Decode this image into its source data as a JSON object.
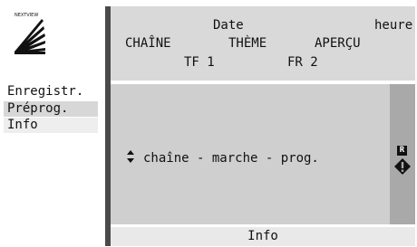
{
  "logo": {
    "text": "NEXTVIEW",
    "icon": "nextview-logo-icon"
  },
  "header": {
    "date_label": "Date",
    "time_label": "heure",
    "channel_label": "CHAÎNE",
    "theme_label": "THÈME",
    "preview_label": "APERÇU",
    "station_1": "TF 1",
    "station_2": "FR 2"
  },
  "menu": {
    "items": [
      {
        "label": "Enregistr."
      },
      {
        "label": "Préprog."
      },
      {
        "label": "Info"
      }
    ]
  },
  "content": {
    "hint_text": "chaîne - marche - prog.",
    "updown_icon": "up-down-arrows-icon"
  },
  "side": {
    "badge": "R",
    "alert_icon": "diamond-exclamation-icon"
  },
  "footer": {
    "label": "Info"
  },
  "colors": {
    "header_bg": "#d9d9d9",
    "content_bg": "#cfcfcf",
    "side_bar_bg": "#a9a9a9",
    "divider": "#4a4a4a"
  }
}
